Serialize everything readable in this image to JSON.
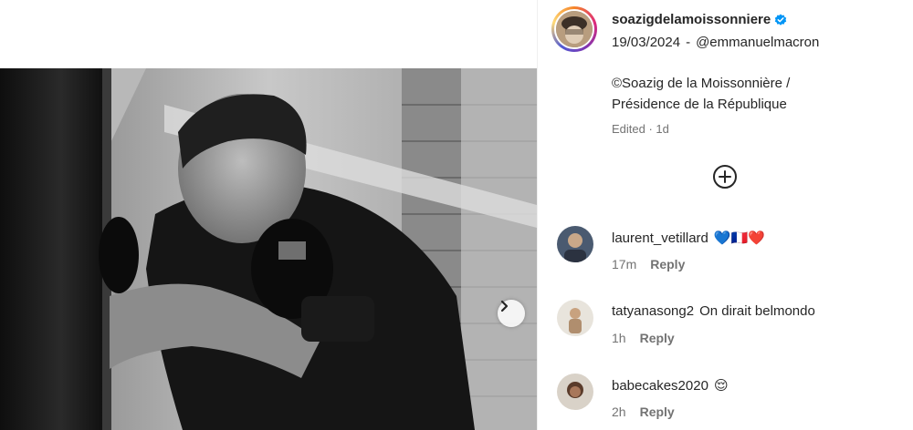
{
  "post": {
    "author": "soazigdelamoissonniere",
    "date": "19/03/2024",
    "separator": "-",
    "mention": "@emmanuelmacron",
    "caption_line1": "©Soazig de la Moissonnière /",
    "caption_line2": "Présidence de la République",
    "edited": "Edited · 1d"
  },
  "comments": [
    {
      "user": "laurent_vetillard",
      "text": "",
      "emoji": "💙🇫🇷❤️",
      "time": "17m",
      "reply": "Reply"
    },
    {
      "user": "tatyanasong2",
      "text": "On dirait belmondo",
      "emoji": "",
      "time": "1h",
      "reply": "Reply"
    },
    {
      "user": "babecakes2020",
      "text": "",
      "emoji": "😌",
      "time": "2h",
      "reply": "Reply"
    }
  ],
  "icons": {
    "verified": "verified-badge-icon",
    "carousel_next": "chevron-right-icon",
    "load_more": "plus-circle-icon"
  },
  "colors": {
    "verified_blue": "#0095f6",
    "meta_gray": "#737373"
  }
}
